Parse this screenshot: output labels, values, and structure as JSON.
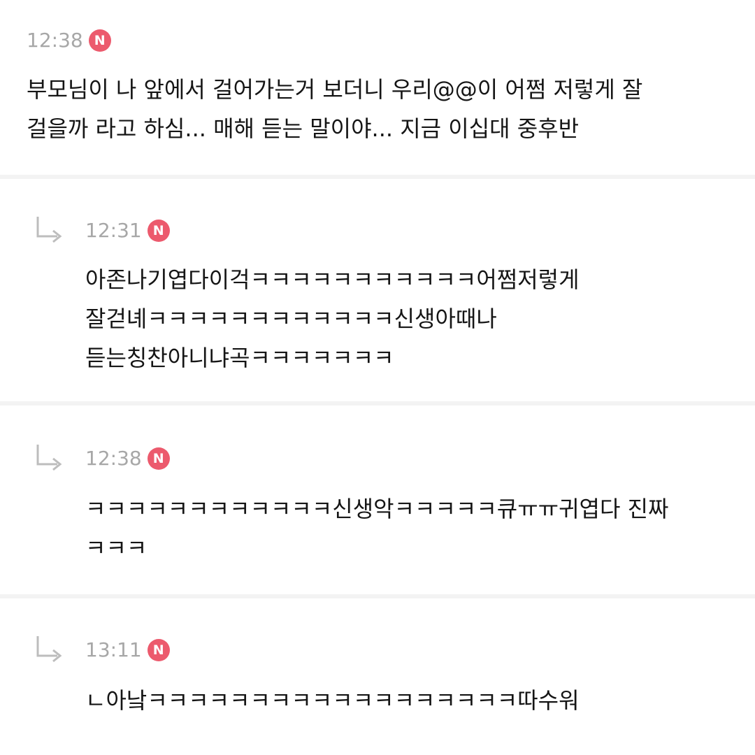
{
  "comments": [
    {
      "time": "12:38",
      "badge": "N",
      "text": "부모님이 나 앞에서 걸어가는거 보더니 우리@@이 어쩜 저렇게 잘\n걸을까 라고 하심... 매해 듣는 말이야... 지금 이십대 중후반"
    },
    {
      "time": "12:31",
      "badge": "N",
      "is_reply": true,
      "reply_icon": "reply-arrow-icon",
      "text": "아존나기엽다이걱ㅋㅋㅋㅋㅋㅋㅋㅋㅋㅋㅋ어쩜저렇게\n잘걷녜ㅋㅋㅋㅋㅋㅋㅋㅋㅋㅋㅋㅋ신생아때나\n듣는칭찬아니냐곡ㅋㅋㅋㅋㅋㅋㅋ"
    },
    {
      "time": "12:38",
      "badge": "N",
      "is_reply": true,
      "reply_icon": "reply-arrow-icon",
      "text": "ㅋㅋㅋㅋㅋㅋㅋㅋㅋㅋㅋㅋ신생악ㅋㅋㅋㅋㅋ큐ㅠㅠ귀엽다 진짜\nㅋㅋㅋ"
    },
    {
      "time": "13:11",
      "badge": "N",
      "is_reply": true,
      "reply_icon": "reply-arrow-icon",
      "text": "ㄴ아낰ㅋㅋㅋㅋㅋㅋㅋㅋㅋㅋㅋㅋㅋㅋㅋㅋㅋㅋ따수워"
    }
  ],
  "colors": {
    "badge": "#ec5a6d",
    "time": "#a7a7a7",
    "divider": "#f3f3f3",
    "text": "#151515"
  }
}
